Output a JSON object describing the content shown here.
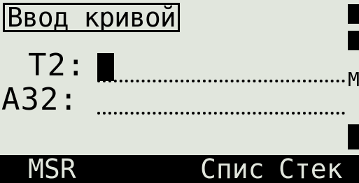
{
  "screen": {
    "title": "Ввод кривой",
    "fields": [
      {
        "label": "T2:",
        "value": ""
      },
      {
        "label": "A32:",
        "value": ""
      }
    ],
    "unit_hint": "M"
  },
  "softkeys": [
    "MSR",
    "Спис",
    "Стек"
  ],
  "colors": {
    "lcd_background": "#e1e6dd",
    "lcd_foreground": "#000000"
  }
}
